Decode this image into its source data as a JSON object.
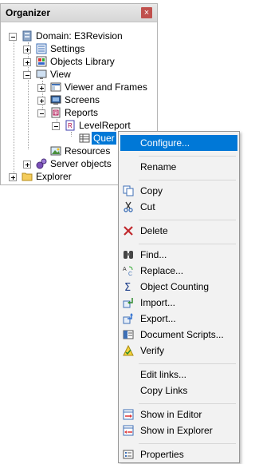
{
  "panel": {
    "title": "Organizer",
    "close_glyph": "×"
  },
  "tree": {
    "domain": "Domain: E3Revision",
    "settings": "Settings",
    "objects_library": "Objects Library",
    "view": "View",
    "viewer_and_frames": "Viewer and Frames",
    "screens": "Screens",
    "reports": "Reports",
    "levelreport": "LevelReport",
    "query": "Quer",
    "resources": "Resources",
    "server_objects": "Server objects",
    "explorer": "Explorer"
  },
  "menu": {
    "configure": "Configure...",
    "rename": "Rename",
    "copy": "Copy",
    "cut": "Cut",
    "delete": "Delete",
    "find": "Find...",
    "replace": "Replace...",
    "object_counting": "Object Counting",
    "import": "Import...",
    "export": "Export...",
    "document_scripts": "Document Scripts...",
    "verify": "Verify",
    "edit_links": "Edit links...",
    "copy_links": "Copy Links",
    "show_in_editor": "Show in Editor",
    "show_in_explorer": "Show in Explorer",
    "properties": "Properties"
  },
  "colors": {
    "selection": "#0078d7",
    "menu_bg": "#f2f2f2",
    "close_bg": "#c0504d"
  }
}
